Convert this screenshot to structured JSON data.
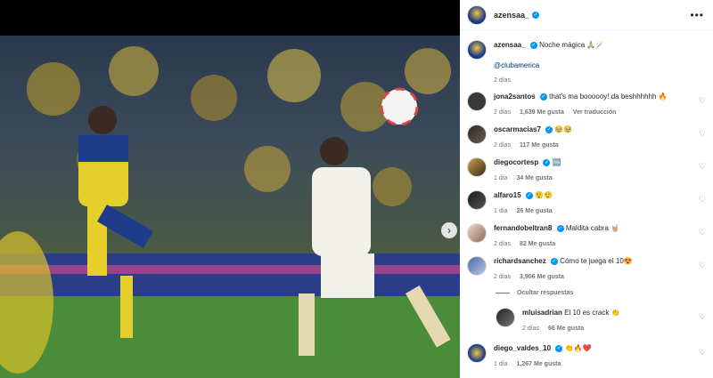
{
  "post": {
    "author": "azensaa_",
    "caption": "Noche mágica 🙏🏼🪄",
    "mention": "@clubamerica",
    "time_ago": "2 días"
  },
  "icons": {
    "more": "more-options-icon",
    "verified": "verified-badge-icon",
    "heart": "heart-icon",
    "next": "chevron-right-icon"
  },
  "comments": [
    {
      "user": "jona2santos",
      "verified": true,
      "text": "that's ma boooooy! da beshhhhhh 🔥",
      "time": "2 días",
      "likes": "1,639 Me gusta",
      "extra": "Ver traducción"
    },
    {
      "user": "oscarmacias7",
      "verified": true,
      "text": "🥹🥹",
      "time": "2 días",
      "likes": "117 Me gusta"
    },
    {
      "user": "diegocortesp",
      "verified": true,
      "text": "🆒",
      "time": "1 día",
      "likes": "34 Me gusta"
    },
    {
      "user": "alfaro15",
      "verified": true,
      "text": "😮‍💨😮‍💨",
      "time": "1 día",
      "likes": "26 Me gusta"
    },
    {
      "user": "fernandobeltran8",
      "verified": true,
      "text": "Maldita cabra 🤘🏼",
      "time": "2 días",
      "likes": "82 Me gusta"
    },
    {
      "user": "richardsanchez",
      "verified": true,
      "text": "Cómo te juega el 10😍",
      "time": "2 días",
      "likes": "3,906 Me gusta"
    }
  ],
  "hide_replies_label": "Ocultar respuestas",
  "reply": {
    "user": "mluisadrian",
    "verified": false,
    "text": "El 10 es crack 👏",
    "time": "2 días",
    "likes": "66 Me gusta"
  },
  "last_comment": {
    "user": "diego_valdes_10",
    "verified": true,
    "text": "👏🔥❤️",
    "time": "1 día",
    "likes": "1,267 Me gusta"
  }
}
